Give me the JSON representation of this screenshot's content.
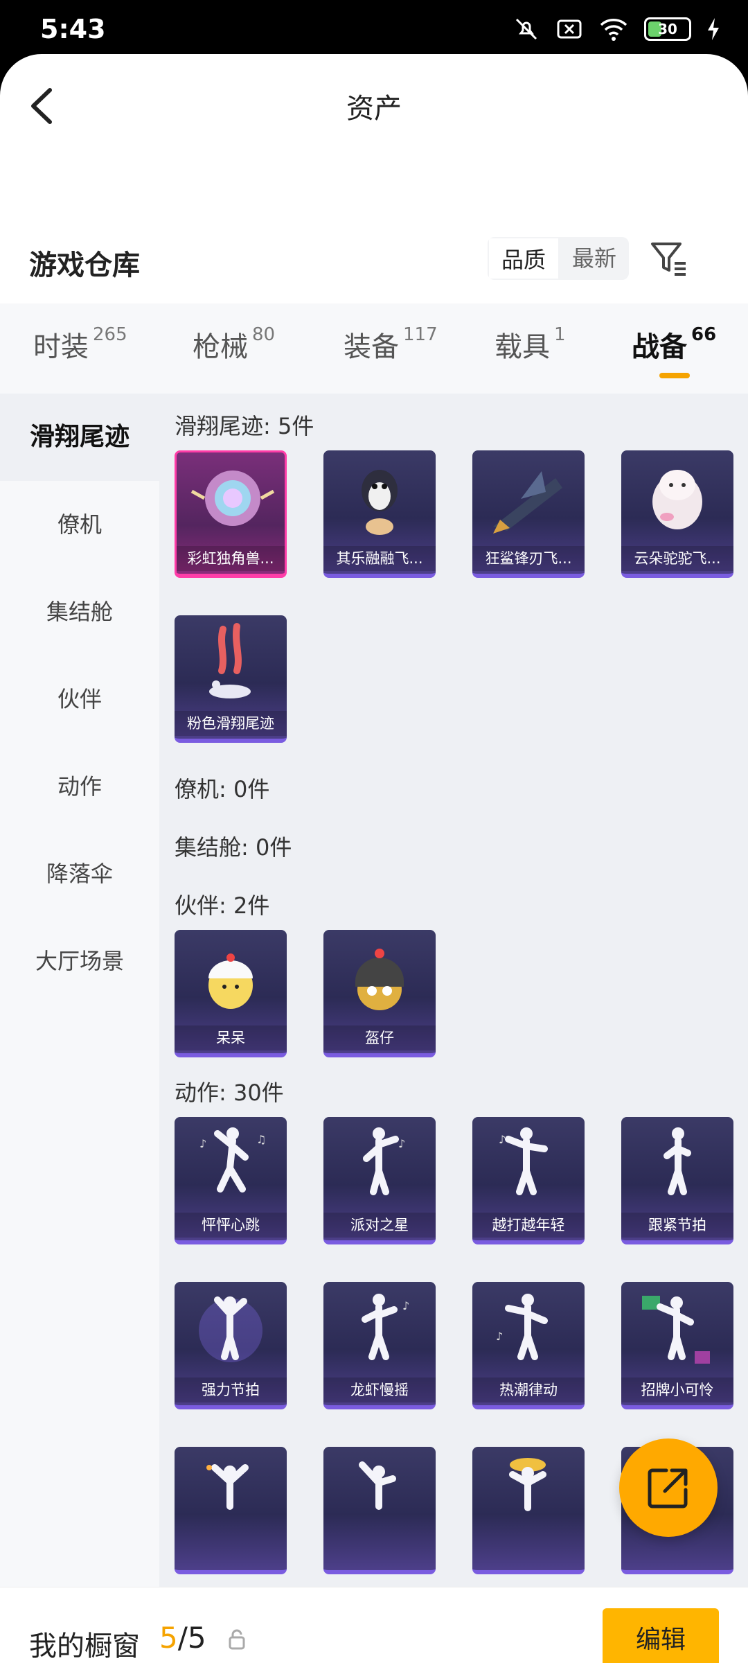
{
  "status_bar": {
    "time": "5:43",
    "battery": "30"
  },
  "header": {
    "title": "资产"
  },
  "warehouse": {
    "title": "游戏仓库",
    "sort_options": [
      "品质",
      "最新"
    ],
    "selected_sort": "品质"
  },
  "tabs": [
    {
      "label": "时装",
      "count": "265"
    },
    {
      "label": "枪械",
      "count": "80"
    },
    {
      "label": "装备",
      "count": "117"
    },
    {
      "label": "载具",
      "count": "1"
    },
    {
      "label": "战备",
      "count": "66"
    }
  ],
  "active_tab": "战备",
  "sidebar": {
    "items": [
      {
        "label": "滑翔尾迹"
      },
      {
        "label": "僚机"
      },
      {
        "label": "集结舱"
      },
      {
        "label": "伙伴"
      },
      {
        "label": "动作"
      },
      {
        "label": "降落伞"
      },
      {
        "label": "大厅场景"
      }
    ],
    "active": "滑翔尾迹"
  },
  "categories": [
    {
      "heading": "滑翔尾迹: 5件",
      "items": [
        "彩虹独角兽...",
        "其乐融融飞...",
        "狂鲨锋刃飞...",
        "云朵驼驼飞...",
        "粉色滑翔尾迹"
      ]
    },
    {
      "heading": "僚机: 0件",
      "items": []
    },
    {
      "heading": "集结舱: 0件",
      "items": []
    },
    {
      "heading": "伙伴: 2件",
      "items": [
        "呆呆",
        "盔仔"
      ]
    },
    {
      "heading": "动作: 30件",
      "items": [
        "怦怦心跳",
        "派对之星",
        "越打越年轻",
        "跟紧节拍",
        "强力节拍",
        "龙虾慢摇",
        "热潮律动",
        "招牌小可怜"
      ]
    }
  ],
  "bottom_bar": {
    "label": "我的橱窗",
    "count_current": "5",
    "count_sep": "/",
    "count_total": "5",
    "edit_label": "编辑"
  },
  "colors": {
    "accent": "#ffb500",
    "tab_underline": "#f5a300",
    "legendary_border": "#ff3da8",
    "epic_border": "#7a5ce0"
  }
}
